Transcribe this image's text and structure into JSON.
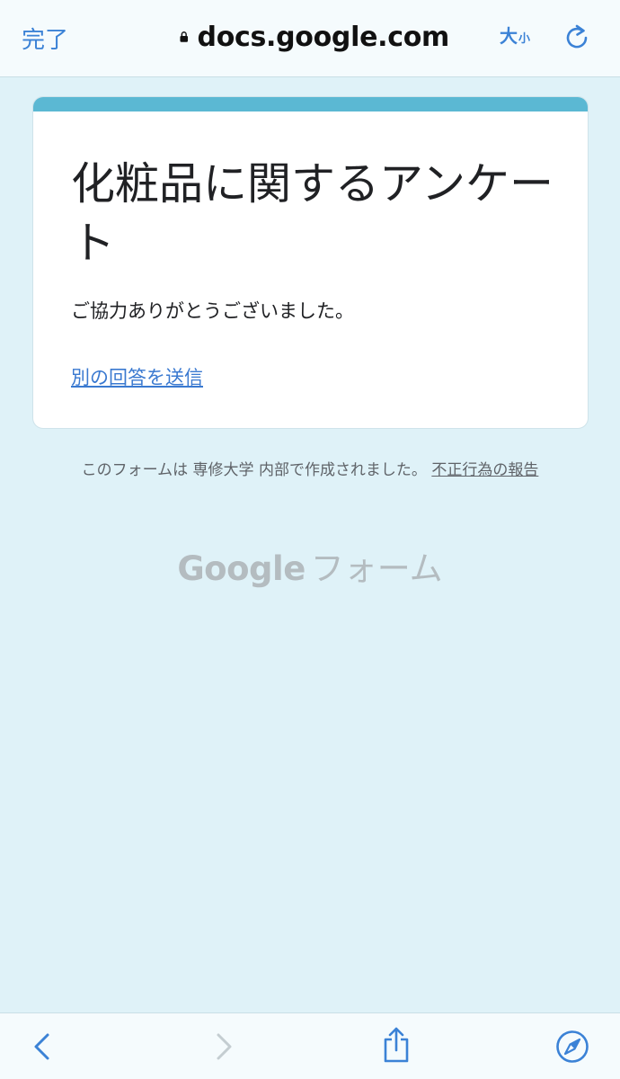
{
  "browser": {
    "done_label": "完了",
    "url": "docs.google.com",
    "textsize_big": "大",
    "textsize_small": "小",
    "accent_color": "#3b82d6"
  },
  "form": {
    "title": "化粧品に関するアンケート",
    "thanks_message": "ご協力ありがとうございました。",
    "resubmit_link": "別の回答を送信",
    "accent_color": "#5bb8d3"
  },
  "footer": {
    "note": "このフォームは 専修大学 内部で作成されました。",
    "abuse_link": "不正行為の報告"
  },
  "brand": {
    "google": "Google",
    "product": "フォーム"
  },
  "toolbar": {
    "icons": [
      "back-icon",
      "forward-icon",
      "share-icon",
      "safari-icon"
    ]
  }
}
